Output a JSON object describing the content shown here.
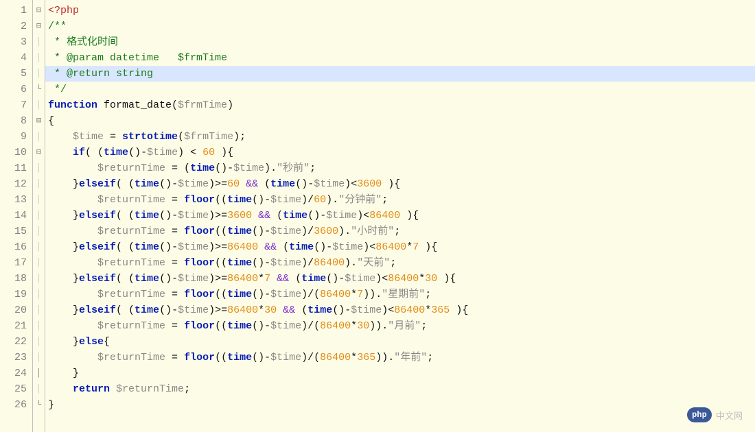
{
  "line_count": 26,
  "fold_marks": {
    "1": "⊟",
    "2": "⊟",
    "6": "└",
    "8": "⊟",
    "10": "⊟",
    "24": "│",
    "26": "└"
  },
  "highlighted_line": 5,
  "logo": {
    "badge": "php",
    "text": "中文网"
  },
  "code": [
    [
      {
        "c": "k-red",
        "t": "<?php"
      }
    ],
    [
      {
        "c": "k-green",
        "t": "/**"
      }
    ],
    [
      {
        "c": "k-green",
        "t": " * 格式化时间"
      }
    ],
    [
      {
        "c": "k-green",
        "t": " * @param datetime   $frmTime"
      }
    ],
    [
      {
        "c": "k-green",
        "t": " * @return string"
      }
    ],
    [
      {
        "c": "k-green",
        "t": " */"
      }
    ],
    [
      {
        "c": "k-blue",
        "t": "function"
      },
      {
        "c": "k-black",
        "t": " format_date("
      },
      {
        "c": "k-gray",
        "t": "$frmTime"
      },
      {
        "c": "k-black",
        "t": ")"
      }
    ],
    [
      {
        "c": "k-black",
        "t": "{"
      }
    ],
    [
      {
        "c": "k-black",
        "t": "    "
      },
      {
        "c": "k-gray",
        "t": "$time"
      },
      {
        "c": "k-black",
        "t": " = "
      },
      {
        "c": "k-blue",
        "t": "strtotime"
      },
      {
        "c": "k-black",
        "t": "("
      },
      {
        "c": "k-gray",
        "t": "$frmTime"
      },
      {
        "c": "k-black",
        "t": ");"
      }
    ],
    [
      {
        "c": "k-black",
        "t": "    "
      },
      {
        "c": "k-blue",
        "t": "if"
      },
      {
        "c": "k-black",
        "t": "( ("
      },
      {
        "c": "k-blue",
        "t": "time"
      },
      {
        "c": "k-black",
        "t": "()-"
      },
      {
        "c": "k-gray",
        "t": "$time"
      },
      {
        "c": "k-black",
        "t": ") < "
      },
      {
        "c": "k-orange",
        "t": "60"
      },
      {
        "c": "k-black",
        "t": " ){"
      }
    ],
    [
      {
        "c": "k-black",
        "t": "        "
      },
      {
        "c": "k-gray",
        "t": "$returnTime"
      },
      {
        "c": "k-black",
        "t": " = ("
      },
      {
        "c": "k-blue",
        "t": "time"
      },
      {
        "c": "k-black",
        "t": "()-"
      },
      {
        "c": "k-gray",
        "t": "$time"
      },
      {
        "c": "k-black",
        "t": ")."
      },
      {
        "c": "k-gray",
        "t": "\"秒前\""
      },
      {
        "c": "k-black",
        "t": ";"
      }
    ],
    [
      {
        "c": "k-black",
        "t": "    }"
      },
      {
        "c": "k-blue",
        "t": "elseif"
      },
      {
        "c": "k-black",
        "t": "( ("
      },
      {
        "c": "k-blue",
        "t": "time"
      },
      {
        "c": "k-black",
        "t": "()-"
      },
      {
        "c": "k-gray",
        "t": "$time"
      },
      {
        "c": "k-black",
        "t": ")>="
      },
      {
        "c": "k-orange",
        "t": "60"
      },
      {
        "c": "k-black",
        "t": " "
      },
      {
        "c": "k-purple",
        "t": "&&"
      },
      {
        "c": "k-black",
        "t": " ("
      },
      {
        "c": "k-blue",
        "t": "time"
      },
      {
        "c": "k-black",
        "t": "()-"
      },
      {
        "c": "k-gray",
        "t": "$time"
      },
      {
        "c": "k-black",
        "t": ")<"
      },
      {
        "c": "k-orange",
        "t": "3600"
      },
      {
        "c": "k-black",
        "t": " ){"
      }
    ],
    [
      {
        "c": "k-black",
        "t": "        "
      },
      {
        "c": "k-gray",
        "t": "$returnTime"
      },
      {
        "c": "k-black",
        "t": " = "
      },
      {
        "c": "k-blue",
        "t": "floor"
      },
      {
        "c": "k-black",
        "t": "(("
      },
      {
        "c": "k-blue",
        "t": "time"
      },
      {
        "c": "k-black",
        "t": "()-"
      },
      {
        "c": "k-gray",
        "t": "$time"
      },
      {
        "c": "k-black",
        "t": ")/"
      },
      {
        "c": "k-orange",
        "t": "60"
      },
      {
        "c": "k-black",
        "t": ")."
      },
      {
        "c": "k-gray",
        "t": "\"分钟前\""
      },
      {
        "c": "k-black",
        "t": ";"
      }
    ],
    [
      {
        "c": "k-black",
        "t": "    }"
      },
      {
        "c": "k-blue",
        "t": "elseif"
      },
      {
        "c": "k-black",
        "t": "( ("
      },
      {
        "c": "k-blue",
        "t": "time"
      },
      {
        "c": "k-black",
        "t": "()-"
      },
      {
        "c": "k-gray",
        "t": "$time"
      },
      {
        "c": "k-black",
        "t": ")>="
      },
      {
        "c": "k-orange",
        "t": "3600"
      },
      {
        "c": "k-black",
        "t": " "
      },
      {
        "c": "k-purple",
        "t": "&&"
      },
      {
        "c": "k-black",
        "t": " ("
      },
      {
        "c": "k-blue",
        "t": "time"
      },
      {
        "c": "k-black",
        "t": "()-"
      },
      {
        "c": "k-gray",
        "t": "$time"
      },
      {
        "c": "k-black",
        "t": ")<"
      },
      {
        "c": "k-orange",
        "t": "86400"
      },
      {
        "c": "k-black",
        "t": " ){"
      }
    ],
    [
      {
        "c": "k-black",
        "t": "        "
      },
      {
        "c": "k-gray",
        "t": "$returnTime"
      },
      {
        "c": "k-black",
        "t": " = "
      },
      {
        "c": "k-blue",
        "t": "floor"
      },
      {
        "c": "k-black",
        "t": "(("
      },
      {
        "c": "k-blue",
        "t": "time"
      },
      {
        "c": "k-black",
        "t": "()-"
      },
      {
        "c": "k-gray",
        "t": "$time"
      },
      {
        "c": "k-black",
        "t": ")/"
      },
      {
        "c": "k-orange",
        "t": "3600"
      },
      {
        "c": "k-black",
        "t": ")."
      },
      {
        "c": "k-gray",
        "t": "\"小时前\""
      },
      {
        "c": "k-black",
        "t": ";"
      }
    ],
    [
      {
        "c": "k-black",
        "t": "    }"
      },
      {
        "c": "k-blue",
        "t": "elseif"
      },
      {
        "c": "k-black",
        "t": "( ("
      },
      {
        "c": "k-blue",
        "t": "time"
      },
      {
        "c": "k-black",
        "t": "()-"
      },
      {
        "c": "k-gray",
        "t": "$time"
      },
      {
        "c": "k-black",
        "t": ")>="
      },
      {
        "c": "k-orange",
        "t": "86400"
      },
      {
        "c": "k-black",
        "t": " "
      },
      {
        "c": "k-purple",
        "t": "&&"
      },
      {
        "c": "k-black",
        "t": " ("
      },
      {
        "c": "k-blue",
        "t": "time"
      },
      {
        "c": "k-black",
        "t": "()-"
      },
      {
        "c": "k-gray",
        "t": "$time"
      },
      {
        "c": "k-black",
        "t": ")<"
      },
      {
        "c": "k-orange",
        "t": "86400"
      },
      {
        "c": "k-black",
        "t": "*"
      },
      {
        "c": "k-orange",
        "t": "7"
      },
      {
        "c": "k-black",
        "t": " ){"
      }
    ],
    [
      {
        "c": "k-black",
        "t": "        "
      },
      {
        "c": "k-gray",
        "t": "$returnTime"
      },
      {
        "c": "k-black",
        "t": " = "
      },
      {
        "c": "k-blue",
        "t": "floor"
      },
      {
        "c": "k-black",
        "t": "(("
      },
      {
        "c": "k-blue",
        "t": "time"
      },
      {
        "c": "k-black",
        "t": "()-"
      },
      {
        "c": "k-gray",
        "t": "$time"
      },
      {
        "c": "k-black",
        "t": ")/"
      },
      {
        "c": "k-orange",
        "t": "86400"
      },
      {
        "c": "k-black",
        "t": ")."
      },
      {
        "c": "k-gray",
        "t": "\"天前\""
      },
      {
        "c": "k-black",
        "t": ";"
      }
    ],
    [
      {
        "c": "k-black",
        "t": "    }"
      },
      {
        "c": "k-blue",
        "t": "elseif"
      },
      {
        "c": "k-black",
        "t": "( ("
      },
      {
        "c": "k-blue",
        "t": "time"
      },
      {
        "c": "k-black",
        "t": "()-"
      },
      {
        "c": "k-gray",
        "t": "$time"
      },
      {
        "c": "k-black",
        "t": ")>="
      },
      {
        "c": "k-orange",
        "t": "86400"
      },
      {
        "c": "k-black",
        "t": "*"
      },
      {
        "c": "k-orange",
        "t": "7"
      },
      {
        "c": "k-black",
        "t": " "
      },
      {
        "c": "k-purple",
        "t": "&&"
      },
      {
        "c": "k-black",
        "t": " ("
      },
      {
        "c": "k-blue",
        "t": "time"
      },
      {
        "c": "k-black",
        "t": "()-"
      },
      {
        "c": "k-gray",
        "t": "$time"
      },
      {
        "c": "k-black",
        "t": ")<"
      },
      {
        "c": "k-orange",
        "t": "86400"
      },
      {
        "c": "k-black",
        "t": "*"
      },
      {
        "c": "k-orange",
        "t": "30"
      },
      {
        "c": "k-black",
        "t": " ){"
      }
    ],
    [
      {
        "c": "k-black",
        "t": "        "
      },
      {
        "c": "k-gray",
        "t": "$returnTime"
      },
      {
        "c": "k-black",
        "t": " = "
      },
      {
        "c": "k-blue",
        "t": "floor"
      },
      {
        "c": "k-black",
        "t": "(("
      },
      {
        "c": "k-blue",
        "t": "time"
      },
      {
        "c": "k-black",
        "t": "()-"
      },
      {
        "c": "k-gray",
        "t": "$time"
      },
      {
        "c": "k-black",
        "t": ")/("
      },
      {
        "c": "k-orange",
        "t": "86400"
      },
      {
        "c": "k-black",
        "t": "*"
      },
      {
        "c": "k-orange",
        "t": "7"
      },
      {
        "c": "k-black",
        "t": "))."
      },
      {
        "c": "k-gray",
        "t": "\"星期前\""
      },
      {
        "c": "k-black",
        "t": ";"
      }
    ],
    [
      {
        "c": "k-black",
        "t": "    }"
      },
      {
        "c": "k-blue",
        "t": "elseif"
      },
      {
        "c": "k-black",
        "t": "( ("
      },
      {
        "c": "k-blue",
        "t": "time"
      },
      {
        "c": "k-black",
        "t": "()-"
      },
      {
        "c": "k-gray",
        "t": "$time"
      },
      {
        "c": "k-black",
        "t": ")>="
      },
      {
        "c": "k-orange",
        "t": "86400"
      },
      {
        "c": "k-black",
        "t": "*"
      },
      {
        "c": "k-orange",
        "t": "30"
      },
      {
        "c": "k-black",
        "t": " "
      },
      {
        "c": "k-purple",
        "t": "&&"
      },
      {
        "c": "k-black",
        "t": " ("
      },
      {
        "c": "k-blue",
        "t": "time"
      },
      {
        "c": "k-black",
        "t": "()-"
      },
      {
        "c": "k-gray",
        "t": "$time"
      },
      {
        "c": "k-black",
        "t": ")<"
      },
      {
        "c": "k-orange",
        "t": "86400"
      },
      {
        "c": "k-black",
        "t": "*"
      },
      {
        "c": "k-orange",
        "t": "365"
      },
      {
        "c": "k-black",
        "t": " ){"
      }
    ],
    [
      {
        "c": "k-black",
        "t": "        "
      },
      {
        "c": "k-gray",
        "t": "$returnTime"
      },
      {
        "c": "k-black",
        "t": " = "
      },
      {
        "c": "k-blue",
        "t": "floor"
      },
      {
        "c": "k-black",
        "t": "(("
      },
      {
        "c": "k-blue",
        "t": "time"
      },
      {
        "c": "k-black",
        "t": "()-"
      },
      {
        "c": "k-gray",
        "t": "$time"
      },
      {
        "c": "k-black",
        "t": ")/("
      },
      {
        "c": "k-orange",
        "t": "86400"
      },
      {
        "c": "k-black",
        "t": "*"
      },
      {
        "c": "k-orange",
        "t": "30"
      },
      {
        "c": "k-black",
        "t": "))."
      },
      {
        "c": "k-gray",
        "t": "\"月前\""
      },
      {
        "c": "k-black",
        "t": ";"
      }
    ],
    [
      {
        "c": "k-black",
        "t": "    }"
      },
      {
        "c": "k-blue",
        "t": "else"
      },
      {
        "c": "k-black",
        "t": "{"
      }
    ],
    [
      {
        "c": "k-black",
        "t": "        "
      },
      {
        "c": "k-gray",
        "t": "$returnTime"
      },
      {
        "c": "k-black",
        "t": " = "
      },
      {
        "c": "k-blue",
        "t": "floor"
      },
      {
        "c": "k-black",
        "t": "(("
      },
      {
        "c": "k-blue",
        "t": "time"
      },
      {
        "c": "k-black",
        "t": "()-"
      },
      {
        "c": "k-gray",
        "t": "$time"
      },
      {
        "c": "k-black",
        "t": ")/("
      },
      {
        "c": "k-orange",
        "t": "86400"
      },
      {
        "c": "k-black",
        "t": "*"
      },
      {
        "c": "k-orange",
        "t": "365"
      },
      {
        "c": "k-black",
        "t": "))."
      },
      {
        "c": "k-gray",
        "t": "\"年前\""
      },
      {
        "c": "k-black",
        "t": ";"
      }
    ],
    [
      {
        "c": "k-black",
        "t": "    }"
      }
    ],
    [
      {
        "c": "k-black",
        "t": "    "
      },
      {
        "c": "k-blue",
        "t": "return"
      },
      {
        "c": "k-black",
        "t": " "
      },
      {
        "c": "k-gray",
        "t": "$returnTime"
      },
      {
        "c": "k-black",
        "t": ";"
      }
    ],
    [
      {
        "c": "k-black",
        "t": "}"
      }
    ]
  ]
}
